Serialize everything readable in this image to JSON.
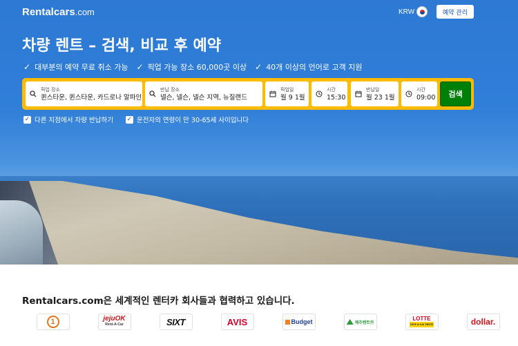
{
  "header": {
    "logo_main": "Rentalcars",
    "logo_domain": ".com",
    "currency": "KRW",
    "manage_label": "예약 관리"
  },
  "hero": {
    "headline": "차량 렌트 – 검색, 비교 후 예약",
    "usps": [
      "대부분의 예약 무료 취소 가능",
      "픽업 가능 장소 60,000곳 이상",
      "40개 이상의 언어로 고객 지원"
    ]
  },
  "search": {
    "pickup_location_label": "픽업 장소",
    "pickup_location_value": "퀸스타운, 퀸스타운, 카드로나 알파인",
    "dropoff_location_label": "반납 장소",
    "dropoff_location_value": "넬슨, 넬슨, 넬슨 지역, 뉴질랜드",
    "pickup_date_label": "픽업일",
    "pickup_date_value": "월 9 1월",
    "pickup_time_label": "시간",
    "pickup_time_value": "15:30",
    "dropoff_date_label": "반납일",
    "dropoff_date_value": "월 23 1월",
    "dropoff_time_label": "시간",
    "dropoff_time_value": "09:00",
    "search_button": "검색"
  },
  "options": {
    "different_location": "다른 지점에서 차량 반납하기",
    "driver_age": "운전자의 연령이 만 30-65세 사이입니다"
  },
  "partners": {
    "title": "Rentalcars.com은 세계적인 렌터카 회사들과 협력하고 있습니다.",
    "logos": [
      {
        "name": "1",
        "color": "#e8731c"
      },
      {
        "name": "jejuOK",
        "sub": "Rent-A-Car",
        "color": "#c8161d"
      },
      {
        "name": "SIXT",
        "color": "#111111"
      },
      {
        "name": "AVIS",
        "color": "#d4002a"
      },
      {
        "name": "Budget",
        "color": "#1f3f8f"
      },
      {
        "name": "제주렌트카",
        "color": "#2c9a3c"
      },
      {
        "name": "LOTTE",
        "sub": "rent-a-car Hertz",
        "color": "#d0021b"
      },
      {
        "name": "dollar.",
        "color": "#c8161d"
      }
    ]
  },
  "colors": {
    "brand_blue": "#2f7ed8",
    "search_yellow": "#febb02",
    "search_green": "#008009"
  }
}
